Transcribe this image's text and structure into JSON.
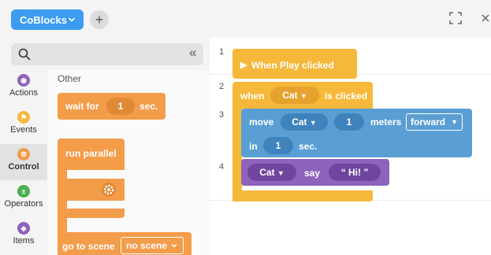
{
  "app": {
    "title": "CoBlocks",
    "add_label": "+"
  },
  "palette": {
    "collapse_label": "«",
    "categories": [
      {
        "label": "Actions",
        "color": "#8f63bb",
        "icon": "actions-icon"
      },
      {
        "label": "Events",
        "color": "#f6b83a",
        "icon": "events-icon"
      },
      {
        "label": "Control",
        "color": "#f39c4a",
        "icon": "control-icon",
        "active": true
      },
      {
        "label": "Operators",
        "color": "#4caf50",
        "icon": "operators-icon"
      },
      {
        "label": "Items",
        "color": "#8f63bb",
        "icon": "items-icon"
      }
    ],
    "section_label": "Other",
    "blocks": {
      "wait_for": "wait for",
      "wait_value": "1",
      "wait_unit": "sec.",
      "run_parallel": "run parallel",
      "go_to_scene": "go to scene",
      "scene_value": "no scene"
    }
  },
  "workspace": {
    "rows": [
      "1",
      "2",
      "3",
      "4"
    ],
    "when_play": "When Play clicked",
    "when": "when",
    "when_target": "Cat",
    "is_clicked": "is clicked",
    "move": "move",
    "move_target": "Cat",
    "move_amount": "1",
    "meters": "meters",
    "direction": "forward",
    "in": "in",
    "in_value": "1",
    "in_unit": "sec.",
    "say_target": "Cat",
    "say": "say",
    "say_text": "“ Hi! ”"
  }
}
